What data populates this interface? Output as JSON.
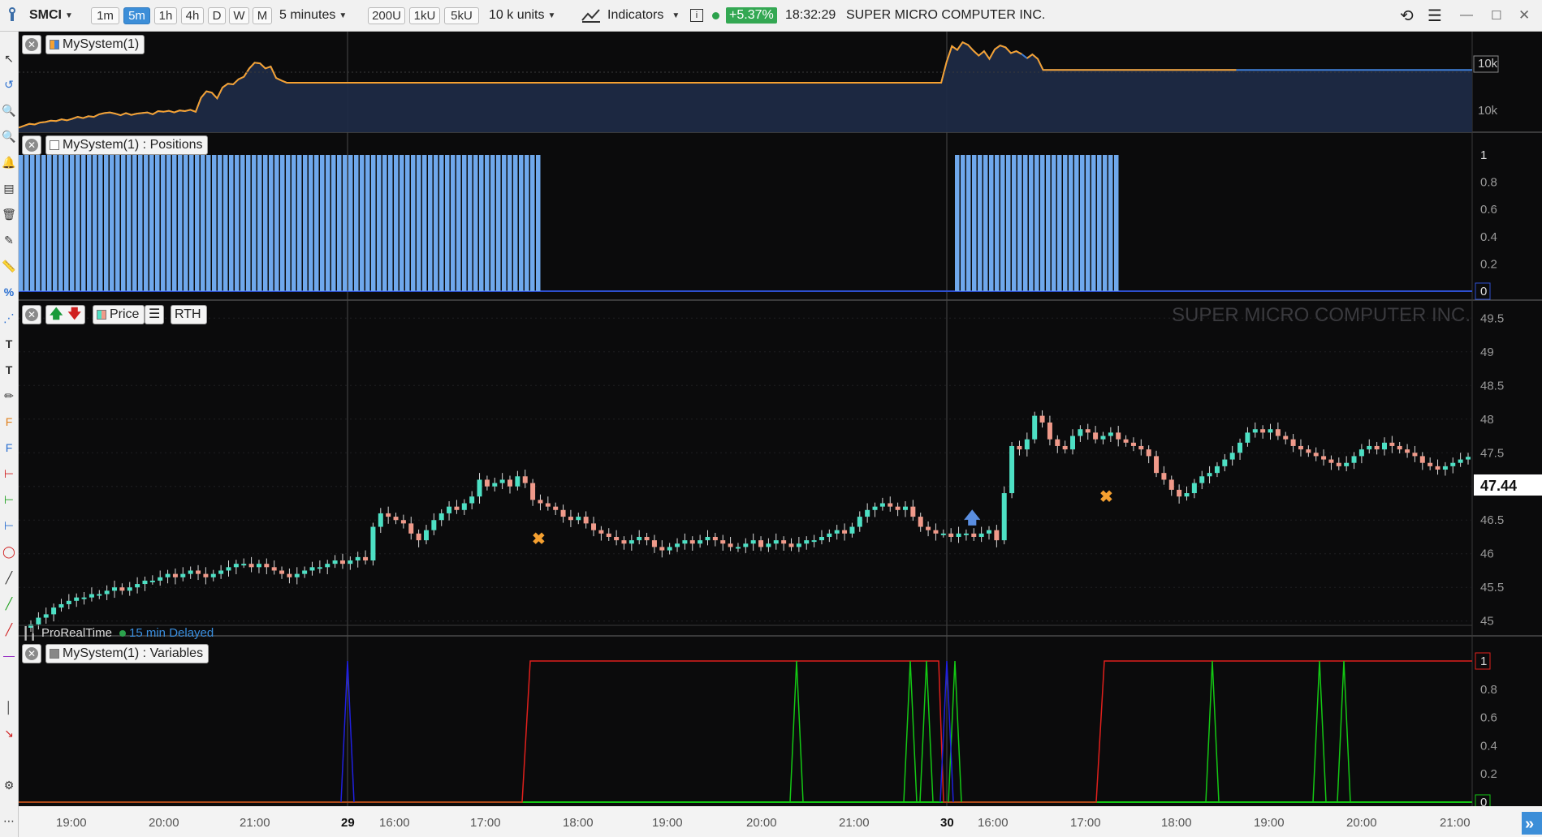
{
  "toolbar": {
    "symbol": "SMCI",
    "timeframes": [
      "1m",
      "5m",
      "1h",
      "4h",
      "D",
      "W",
      "M"
    ],
    "active_timeframe": "5m",
    "period_select": "5 minutes",
    "units": [
      "200U",
      "1kU",
      "5kU"
    ],
    "units_select": "10 k units",
    "indicators_label": "Indicators",
    "change": "+5.37%",
    "time": "18:32:29",
    "company": "SUPER MICRO COMPUTER INC."
  },
  "panels": {
    "equity_title": "MySystem(1)",
    "positions_title": "MySystem(1) : Positions",
    "price_title": "Price",
    "rth_label": "RTH",
    "variables_title": "MySystem(1) : Variables",
    "watermark": "SUPER MICRO COMPUTER INC.",
    "provider": "ProRealTime",
    "delay": "15 min Delayed",
    "current_price": "47.44"
  },
  "colors": {
    "background": "#0b0b0c",
    "bull": "#4de0c4",
    "bear": "#f09a8a",
    "equity_up": "#f5a030",
    "equity_flat": "#3f7fd8",
    "positions": "#6fa8ec",
    "var_red": "#e0201c",
    "var_green": "#14c814",
    "var_blue": "#2020e0",
    "marker": "#f5a030"
  },
  "chart_data": {
    "type": "candlestick",
    "xaxis_labels": [
      "19:00",
      "20:00",
      "21:00",
      "29",
      "16:00",
      "17:00",
      "18:00",
      "19:00",
      "20:00",
      "21:00",
      "30",
      "16:00",
      "17:00",
      "18:00",
      "19:00",
      "20:00",
      "21:00"
    ],
    "equity": {
      "axis_labels": [
        "10k",
        "10k"
      ],
      "values": [
        0.04,
        0.1,
        0.16,
        0.14,
        0.2,
        0.22,
        0.26,
        0.25,
        0.3,
        0.27,
        0.32,
        0.38,
        0.34,
        0.4,
        0.38,
        0.46,
        0.5,
        0.52,
        0.48,
        0.43,
        0.5,
        0.44,
        0.48,
        0.5,
        0.52,
        0.46,
        0.56,
        0.54,
        0.57,
        0.52,
        0.58,
        0.56,
        0.6,
        0.54,
        0.98,
        1.18,
        1.14,
        0.96,
        1.3,
        1.42,
        1.4,
        1.56,
        1.64,
        1.9,
        2.08,
        2.06,
        1.9,
        1.96,
        1.6,
        1.52,
        1.45,
        1.45,
        1.45,
        1.45,
        1.45,
        1.45,
        1.45,
        1.45,
        1.45,
        1.45,
        1.45,
        1.45,
        1.45,
        1.45,
        1.45,
        1.45,
        1.45,
        1.45,
        1.45,
        1.45,
        1.45,
        1.45,
        1.45,
        1.45,
        1.45,
        1.45,
        1.45,
        1.45,
        1.45,
        1.45,
        1.45,
        1.45,
        1.45,
        1.45,
        1.45,
        1.45,
        1.45,
        1.45,
        1.45,
        1.45,
        1.45,
        1.45,
        1.45,
        1.45,
        1.45,
        1.45,
        1.45,
        1.45,
        1.45,
        1.45,
        1.45,
        1.45,
        1.45,
        1.45,
        1.45,
        1.45,
        1.45,
        1.45,
        1.45,
        1.45,
        1.45,
        1.45,
        1.45,
        1.45,
        1.45,
        1.45,
        1.45,
        1.45,
        1.45,
        1.45,
        1.45,
        1.45,
        1.45,
        1.45,
        1.45,
        1.45,
        1.45,
        1.45,
        1.45,
        1.45,
        1.45,
        1.45,
        1.45,
        1.45,
        1.45,
        1.45,
        1.45,
        1.45,
        1.45,
        1.45,
        1.45,
        1.45,
        1.45,
        1.45,
        1.45,
        1.45,
        1.45,
        1.45,
        1.45,
        1.45,
        1.45,
        1.45,
        1.45,
        1.45,
        1.45,
        1.45,
        1.45,
        1.45,
        1.45,
        1.45,
        1.45,
        1.45,
        1.45,
        1.45,
        1.45,
        1.45,
        1.45,
        1.45,
        1.45,
        1.45,
        1.45,
        1.45,
        1.45,
        2.1,
        2.6,
        2.48,
        2.72,
        2.64,
        2.46,
        2.3,
        2.44,
        2.2,
        2.5,
        2.62,
        2.56,
        2.38,
        2.44,
        2.35,
        2.22,
        2.34,
        2.2,
        1.85,
        1.85,
        1.85,
        1.85,
        1.85,
        1.85,
        1.85,
        1.85,
        1.85,
        1.85,
        1.85,
        1.85,
        1.85,
        1.85,
        1.85,
        1.85,
        1.85,
        1.85,
        1.85,
        1.85,
        1.85,
        1.85,
        1.85,
        1.85,
        1.85,
        1.85,
        1.85,
        1.85,
        1.85,
        1.85,
        1.85,
        1.85,
        1.85,
        1.85,
        1.85,
        1.85,
        1.85,
        1.85,
        1.85,
        1.85,
        1.85,
        1.85,
        1.85,
        1.85,
        1.85,
        1.85,
        1.85,
        1.85,
        1.85,
        1.85,
        1.85,
        1.85,
        1.85,
        1.85,
        1.85,
        1.85,
        1.85,
        1.85,
        1.85,
        1.85,
        1.85,
        1.85,
        1.85,
        1.85,
        1.85,
        1.85,
        1.85,
        1.85,
        1.85,
        1.85,
        1.85,
        1.85,
        1.85,
        1.85,
        1.85,
        1.85,
        1.85,
        1.85,
        1.85,
        1.85,
        1.85
      ]
    },
    "positions": {
      "ylim": [
        0,
        1
      ],
      "yticks": [
        "1",
        "0.8",
        "0.6",
        "0.4",
        "0.2",
        "0"
      ],
      "segments": [
        {
          "from": "19:00",
          "to": "17:30",
          "value": 1
        },
        {
          "from": "30",
          "to": "17:10",
          "value": 1
        }
      ]
    },
    "price": {
      "ylim": [
        44.9,
        49.6
      ],
      "yticks": [
        "49.5",
        "49",
        "48.5",
        "48",
        "47.5",
        "47",
        "46.5",
        "46",
        "45.5",
        "45"
      ],
      "last": 47.44,
      "closes": [
        44.95,
        45.05,
        45.1,
        45.2,
        45.25,
        45.3,
        45.35,
        45.35,
        45.4,
        45.4,
        45.45,
        45.5,
        45.45,
        45.5,
        45.55,
        45.6,
        45.6,
        45.65,
        45.7,
        45.65,
        45.7,
        45.75,
        45.7,
        45.65,
        45.7,
        45.75,
        45.8,
        45.85,
        45.85,
        45.8,
        45.85,
        45.8,
        45.75,
        45.7,
        45.65,
        45.7,
        45.75,
        45.8,
        45.8,
        45.85,
        45.9,
        45.85,
        45.9,
        45.95,
        45.9,
        46.4,
        46.6,
        46.55,
        46.5,
        46.45,
        46.3,
        46.2,
        46.35,
        46.5,
        46.6,
        46.7,
        46.65,
        46.75,
        46.85,
        47.1,
        47.0,
        47.05,
        47.1,
        47.0,
        47.15,
        47.05,
        46.8,
        46.75,
        46.7,
        46.65,
        46.55,
        46.5,
        46.55,
        46.45,
        46.35,
        46.3,
        46.25,
        46.2,
        46.15,
        46.2,
        46.25,
        46.2,
        46.1,
        46.05,
        46.1,
        46.15,
        46.2,
        46.15,
        46.2,
        46.25,
        46.2,
        46.15,
        46.1,
        46.1,
        46.15,
        46.2,
        46.1,
        46.15,
        46.2,
        46.15,
        46.1,
        46.15,
        46.2,
        46.2,
        46.25,
        46.3,
        46.35,
        46.3,
        46.4,
        46.55,
        46.65,
        46.7,
        46.75,
        46.7,
        46.65,
        46.7,
        46.55,
        46.4,
        46.35,
        46.3,
        46.3,
        46.25,
        46.3,
        46.3,
        46.25,
        46.3,
        46.35,
        46.2,
        46.9,
        47.6,
        47.55,
        47.7,
        48.05,
        47.95,
        47.7,
        47.6,
        47.55,
        47.75,
        47.85,
        47.8,
        47.7,
        47.75,
        47.8,
        47.7,
        47.65,
        47.6,
        47.55,
        47.45,
        47.2,
        47.1,
        46.95,
        46.85,
        46.9,
        47.05,
        47.15,
        47.2,
        47.3,
        47.4,
        47.5,
        47.65,
        47.8,
        47.85,
        47.8,
        47.85,
        47.75,
        47.7,
        47.6,
        47.55,
        47.5,
        47.45,
        47.4,
        47.35,
        47.3,
        47.35,
        47.45,
        47.55,
        47.6,
        47.55,
        47.65,
        47.6,
        47.55,
        47.5,
        47.45,
        47.35,
        47.3,
        47.25,
        47.3,
        47.35,
        47.4,
        47.44
      ],
      "markers": [
        {
          "type": "exit",
          "at": "17:30"
        },
        {
          "type": "buy",
          "at": "30"
        },
        {
          "type": "exit",
          "at": "17:10"
        }
      ]
    },
    "variables": {
      "ylim": [
        0,
        1
      ],
      "yticks": [
        "1",
        "0.8",
        "0.6",
        "0.4",
        "0.2",
        "0"
      ],
      "red_spikes": [
        "17:25",
        "17:10"
      ],
      "green_spikes": [
        "20:20",
        "20:45",
        "21:00",
        "30",
        "18:15",
        "19:25",
        "19:40"
      ],
      "blue_spikes": [
        "29",
        "30"
      ]
    }
  }
}
